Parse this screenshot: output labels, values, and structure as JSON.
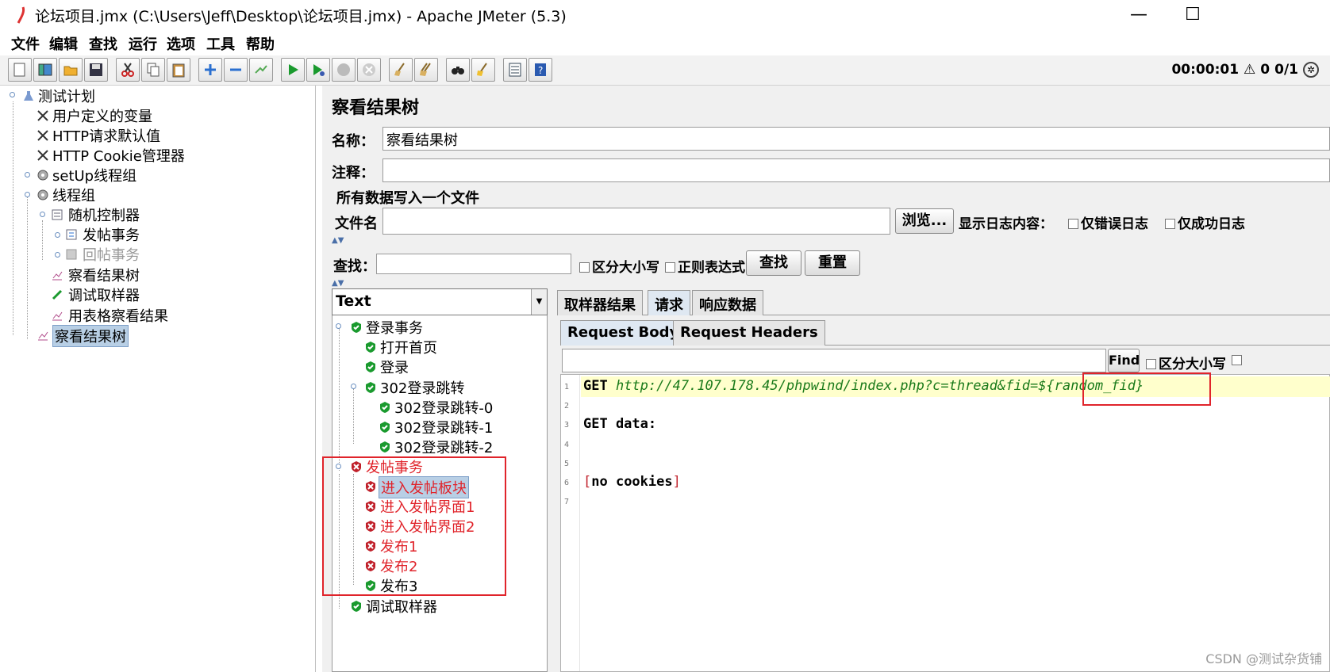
{
  "window": {
    "title": "论坛项目.jmx (C:\\Users\\Jeff\\Desktop\\论坛项目.jmx) - Apache JMeter (5.3)",
    "minimize": "—",
    "maximize": "☐"
  },
  "menu": [
    "文件",
    "编辑",
    "查找",
    "运行",
    "选项",
    "工具",
    "帮助"
  ],
  "toolbar_status": {
    "time": "00:00:01",
    "warnings": "0",
    "threads": "0/1"
  },
  "left_tree": [
    {
      "label": "测试计划",
      "icon": "test-plan-icon"
    },
    {
      "label": "用户定义的变量",
      "icon": "wrench-icon"
    },
    {
      "label": "HTTP请求默认值",
      "icon": "wrench-icon"
    },
    {
      "label": "HTTP Cookie管理器",
      "icon": "wrench-icon"
    },
    {
      "label": "setUp线程组",
      "icon": "gear-icon"
    },
    {
      "label": "线程组",
      "icon": "gear-icon"
    },
    {
      "label": "随机控制器",
      "icon": "controller-icon"
    },
    {
      "label": "发帖事务",
      "icon": "transaction-icon"
    },
    {
      "label": "回帖事务",
      "icon": "transaction-disabled-icon"
    },
    {
      "label": "察看结果树",
      "icon": "chart-icon"
    },
    {
      "label": "调试取样器",
      "icon": "pen-icon"
    },
    {
      "label": "用表格察看结果",
      "icon": "chart-icon"
    },
    {
      "label": "察看结果树",
      "icon": "chart-icon"
    }
  ],
  "panel": {
    "title": "察看结果树",
    "name_label": "名称：",
    "name_value": "察看结果树",
    "comment_label": "注释：",
    "file_group": "所有数据写入一个文件",
    "filename_label": "文件名",
    "browse": "浏览...",
    "log_label": "显示日志内容：",
    "only_errors": "仅错误日志",
    "only_success": "仅成功日志",
    "search_label": "查找：",
    "case_sensitive": "区分大小写",
    "regex": "正则表达式",
    "find_button": "查找",
    "reset_button": "重置"
  },
  "renderer": "Text",
  "results": [
    {
      "label": "登录事务",
      "status": "ok"
    },
    {
      "label": "打开首页",
      "status": "ok"
    },
    {
      "label": "登录",
      "status": "ok"
    },
    {
      "label": "302登录跳转",
      "status": "ok"
    },
    {
      "label": "302登录跳转-0",
      "status": "ok"
    },
    {
      "label": "302登录跳转-1",
      "status": "ok"
    },
    {
      "label": "302登录跳转-2",
      "status": "ok"
    },
    {
      "label": "发帖事务",
      "status": "error"
    },
    {
      "label": "进入发帖板块",
      "status": "error"
    },
    {
      "label": "进入发帖界面1",
      "status": "error"
    },
    {
      "label": "进入发帖界面2",
      "status": "error"
    },
    {
      "label": "发布1",
      "status": "error"
    },
    {
      "label": "发布2",
      "status": "error"
    },
    {
      "label": "发布3",
      "status": "ok"
    },
    {
      "label": "调试取样器",
      "status": "ok"
    }
  ],
  "tabs": [
    "取样器结果",
    "请求",
    "响应数据"
  ],
  "subtabs": [
    "Request Body",
    "Request Headers"
  ],
  "find_bar": {
    "find": "Find",
    "case": "区分大小写"
  },
  "editor": {
    "lines": [
      "1",
      "2",
      "3",
      "4",
      "5",
      "6",
      "7"
    ],
    "get_kw": "GET",
    "url": "http://47.107.178.45/phpwind/index.php?c=thread&fid=",
    "var": "${random_fid}",
    "data_line": "GET data:",
    "cookies_open": "[",
    "cookies_text": "no cookies",
    "cookies_close": "]"
  },
  "watermark": "CSDN @测试杂货铺",
  "colors": {
    "error_red": "#e0242b",
    "ok_green": "#1a9a2e",
    "selection": "#b8cfe5",
    "highlight_line": "#ffffcc"
  }
}
